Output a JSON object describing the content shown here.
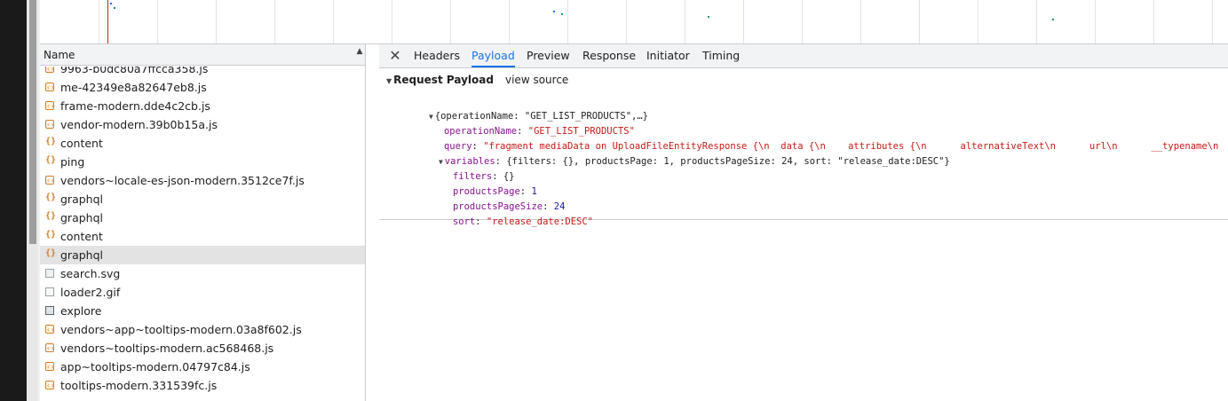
{
  "overview": {
    "has_cursor": true
  },
  "name_column": {
    "header": "Name"
  },
  "requests": [
    {
      "name": "9963-b0dc80a7ffcca358.js",
      "icon": "script-icon",
      "type": "script",
      "selected": false
    },
    {
      "name": "me-42349e8a82647eb8.js",
      "icon": "script-icon",
      "type": "script",
      "selected": false
    },
    {
      "name": "frame-modern.dde4c2cb.js",
      "icon": "script-icon",
      "type": "script",
      "selected": false
    },
    {
      "name": "vendor-modern.39b0b15a.js",
      "icon": "script-icon",
      "type": "script",
      "selected": false
    },
    {
      "name": "content",
      "icon": "xhr-icon",
      "type": "xhr",
      "selected": false
    },
    {
      "name": "ping",
      "icon": "xhr-icon",
      "type": "xhr",
      "selected": false
    },
    {
      "name": "vendors~locale-es-json-modern.3512ce7f.js",
      "icon": "script-icon",
      "type": "script",
      "selected": false
    },
    {
      "name": "graphql",
      "icon": "xhr-icon",
      "type": "xhr",
      "selected": false
    },
    {
      "name": "graphql",
      "icon": "xhr-icon",
      "type": "xhr",
      "selected": false
    },
    {
      "name": "content",
      "icon": "xhr-icon",
      "type": "xhr",
      "selected": false
    },
    {
      "name": "graphql",
      "icon": "xhr-icon",
      "type": "xhr",
      "selected": true
    },
    {
      "name": "search.svg",
      "icon": "image-icon",
      "type": "img",
      "selected": false
    },
    {
      "name": "loader2.gif",
      "icon": "image-icon",
      "type": "gif",
      "selected": false
    },
    {
      "name": "explore",
      "icon": "document-icon",
      "type": "doc",
      "selected": false
    },
    {
      "name": "vendors~app~tooltips-modern.03a8f602.js",
      "icon": "script-icon",
      "type": "script",
      "selected": false
    },
    {
      "name": "vendors~tooltips-modern.ac568468.js",
      "icon": "script-icon",
      "type": "script",
      "selected": false
    },
    {
      "name": "app~tooltips-modern.04797c84.js",
      "icon": "script-icon",
      "type": "script",
      "selected": false
    },
    {
      "name": "tooltips-modern.331539fc.js",
      "icon": "script-icon",
      "type": "script",
      "selected": false
    }
  ],
  "tabs": [
    {
      "label": "Headers",
      "active": false
    },
    {
      "label": "Payload",
      "active": true
    },
    {
      "label": "Preview",
      "active": false
    },
    {
      "label": "Response",
      "active": false
    },
    {
      "label": "Initiator",
      "active": false
    },
    {
      "label": "Timing",
      "active": false
    }
  ],
  "payload": {
    "section_title": "Request Payload",
    "view_source": "view source",
    "summary": "{operationName: \"GET_LIST_PRODUCTS\",…}",
    "operationName_key": "operationName",
    "operationName_value": "\"GET_LIST_PRODUCTS\"",
    "query_key": "query",
    "query_value": "\"fragment mediaData on UploadFileEntityResponse {\\n  data {\\n    attributes {\\n      alternativeText\\n      url\\n      __typename\\n",
    "variables_key": "variables",
    "variables_summary": "{filters: {}, productsPage: 1, productsPageSize: 24, sort: \"release_date:DESC\"}",
    "filters_key": "filters",
    "filters_value": "{}",
    "productsPage_key": "productsPage",
    "productsPage_value": "1",
    "productsPageSize_key": "productsPageSize",
    "productsPageSize_value": "24",
    "sort_key": "sort",
    "sort_value": "\"release_date:DESC\""
  }
}
